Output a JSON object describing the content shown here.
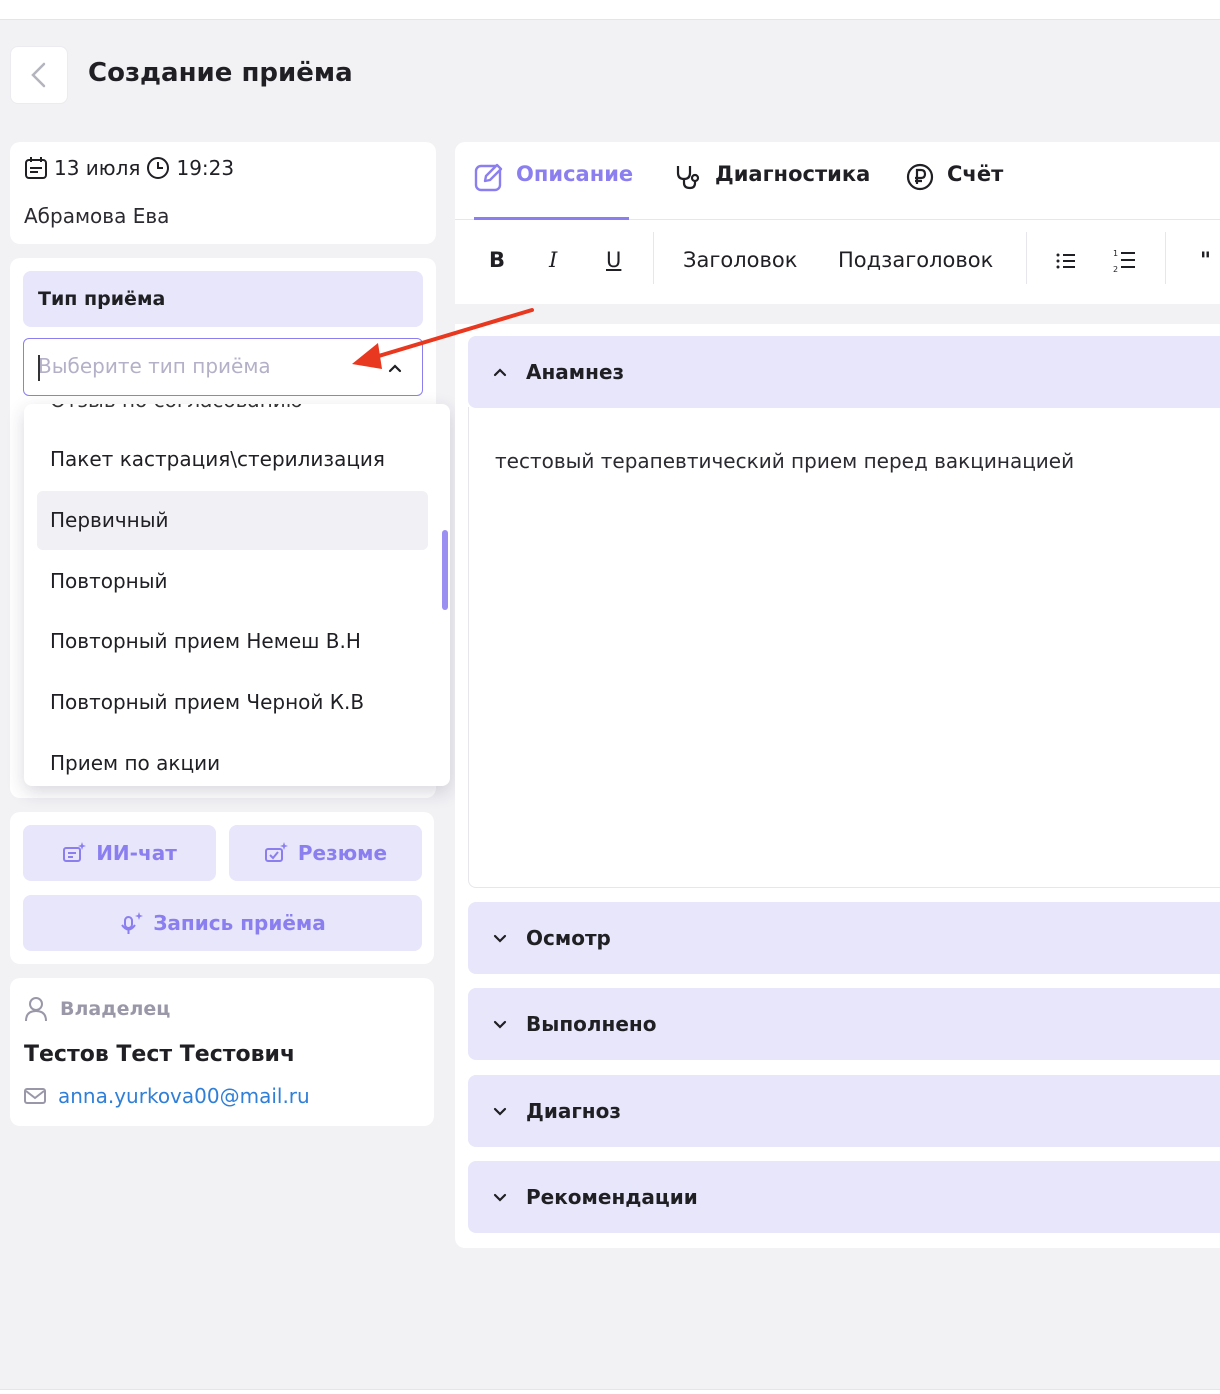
{
  "page": {
    "title": "Создание приёма"
  },
  "visit": {
    "date": "13 июля",
    "time": "19:23",
    "patient": "Абрамова Ева"
  },
  "appointment_type": {
    "header": "Тип приёма",
    "placeholder": "Выберите тип приёма",
    "options_partial_top": "Отзыв по согласованию",
    "options": [
      "Пакет кастрация\\стерилизация",
      "Первичный",
      "Повторный",
      "Повторный прием Немеш В.Н",
      "Повторный прием Черной К.В",
      "Прием по акции"
    ],
    "highlighted_index": 1
  },
  "ai": {
    "chat": "ИИ-чат",
    "resume": "Резюме",
    "record": "Запись приёма"
  },
  "owner": {
    "label": "Владелец",
    "name": "Тестов Тест Тестович",
    "email": "anna.yurkova00@mail.ru"
  },
  "tabs": [
    {
      "label": "Описание",
      "icon": "edit-icon",
      "active": true
    },
    {
      "label": "Диагностика",
      "icon": "stethoscope-icon",
      "active": false
    },
    {
      "label": "Счёт",
      "icon": "ruble-icon",
      "active": false
    }
  ],
  "toolbar": {
    "bold": "B",
    "italic": "I",
    "underline": "U",
    "heading": "Заголовок",
    "subheading": "Подзаголовок",
    "quote": "\""
  },
  "sections": {
    "anamnez": {
      "title": "Анамнез",
      "text": "тестовый терапевтический прием перед вакцинацией"
    },
    "osmotr": "Осмотр",
    "vypolneno": "Выполнено",
    "diagnoz": "Диагноз",
    "recommend": "Рекомендации"
  },
  "colors": {
    "accent": "#8b7ff0",
    "section_bg": "#e7e6fb",
    "link": "#2f7fd8",
    "arrow": "#e8381f"
  }
}
